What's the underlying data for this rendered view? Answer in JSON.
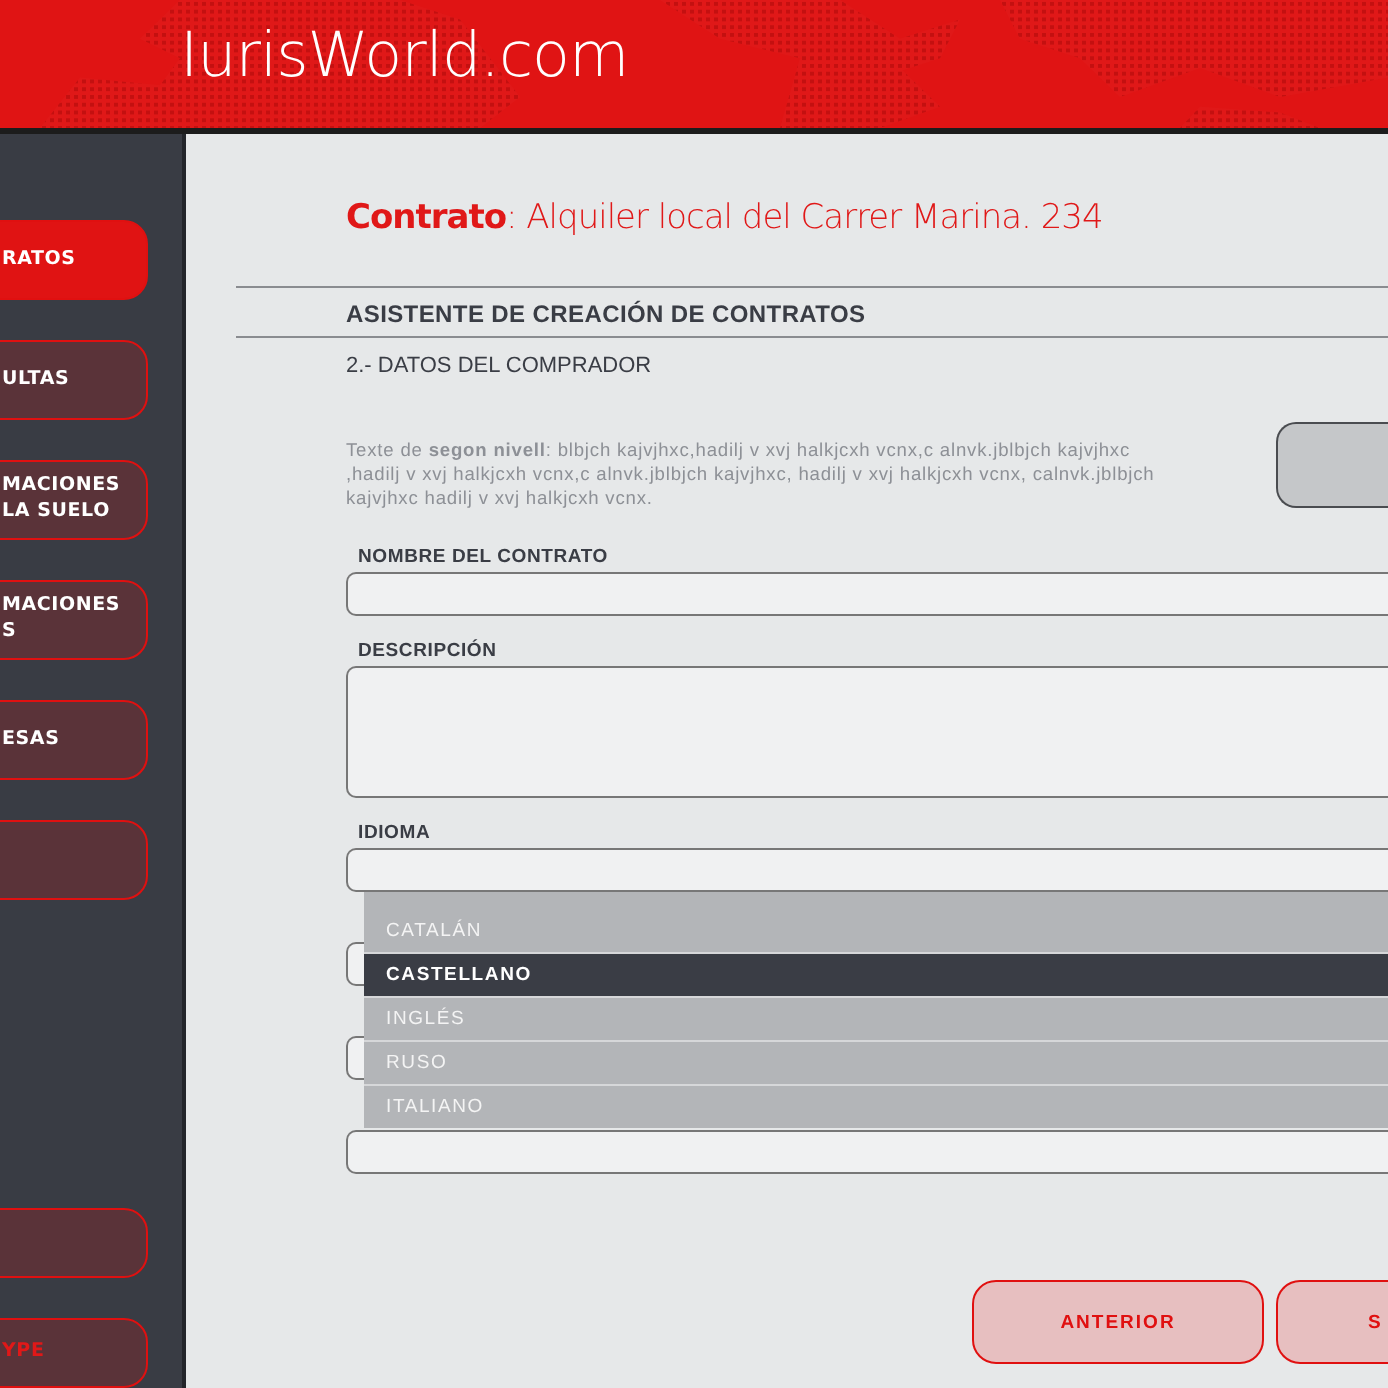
{
  "header": {
    "logo": "IurisWorld.com"
  },
  "sidebar": {
    "items": [
      {
        "label": "RATOS",
        "selected": true,
        "kind": "nav"
      },
      {
        "label": "ULTAS",
        "selected": false,
        "kind": "nav"
      },
      {
        "label": "MACIONES\nLA SUELO",
        "selected": false,
        "kind": "nav"
      },
      {
        "label": "MACIONES\nS",
        "selected": false,
        "kind": "nav"
      },
      {
        "label": "ESAS",
        "selected": false,
        "kind": "nav"
      },
      {
        "selected": false,
        "kind": "nav"
      },
      {
        "kind": "gap"
      },
      {
        "selected": false,
        "kind": "nav"
      },
      {
        "label": "YPE",
        "selected": false,
        "kind": "accent"
      }
    ]
  },
  "title": "**Contrato**: Alquiler local del Carrer Marina. 234",
  "wizard": {
    "heading": "ASISTENTE DE CREACIÓN DE CONTRATOS",
    "step": "2.- DATOS DEL COMPRADOR",
    "help": "Texte de **segon nivell**: blbjch kajvjhxc,hadilj v xvj halkjcxh vcnx,c alnvk.jblbjch kajvjhxc ,hadilj v xvj halkjcxh vcnx,c alnvk.jblbjch kajvjhxc, hadilj v xvj halkjcxh vcnx, calnvk.jblbjch kajvjhxc hadilj v xvj halkjcxh vcnx."
  },
  "fields": [
    {
      "label": "NOMBRE DEL CONTRATO",
      "kind": "input"
    },
    {
      "label": "DESCRIPCIÓN",
      "kind": "textarea"
    },
    {
      "label": "IDIOMA",
      "kind": "input"
    },
    {
      "kind": "input"
    },
    {
      "kind": "input"
    },
    {
      "kind": "input"
    }
  ],
  "dropdown": {
    "options": [
      {
        "label": "CATALÁN",
        "selected": false
      },
      {
        "label": "CASTELLANO",
        "selected": true
      },
      {
        "label": "INGLÉS",
        "selected": false
      },
      {
        "label": "RUSO",
        "selected": false
      },
      {
        "label": "ITALIANO",
        "selected": false
      }
    ]
  },
  "buttons": [
    "ANTERIOR",
    "S"
  ]
}
